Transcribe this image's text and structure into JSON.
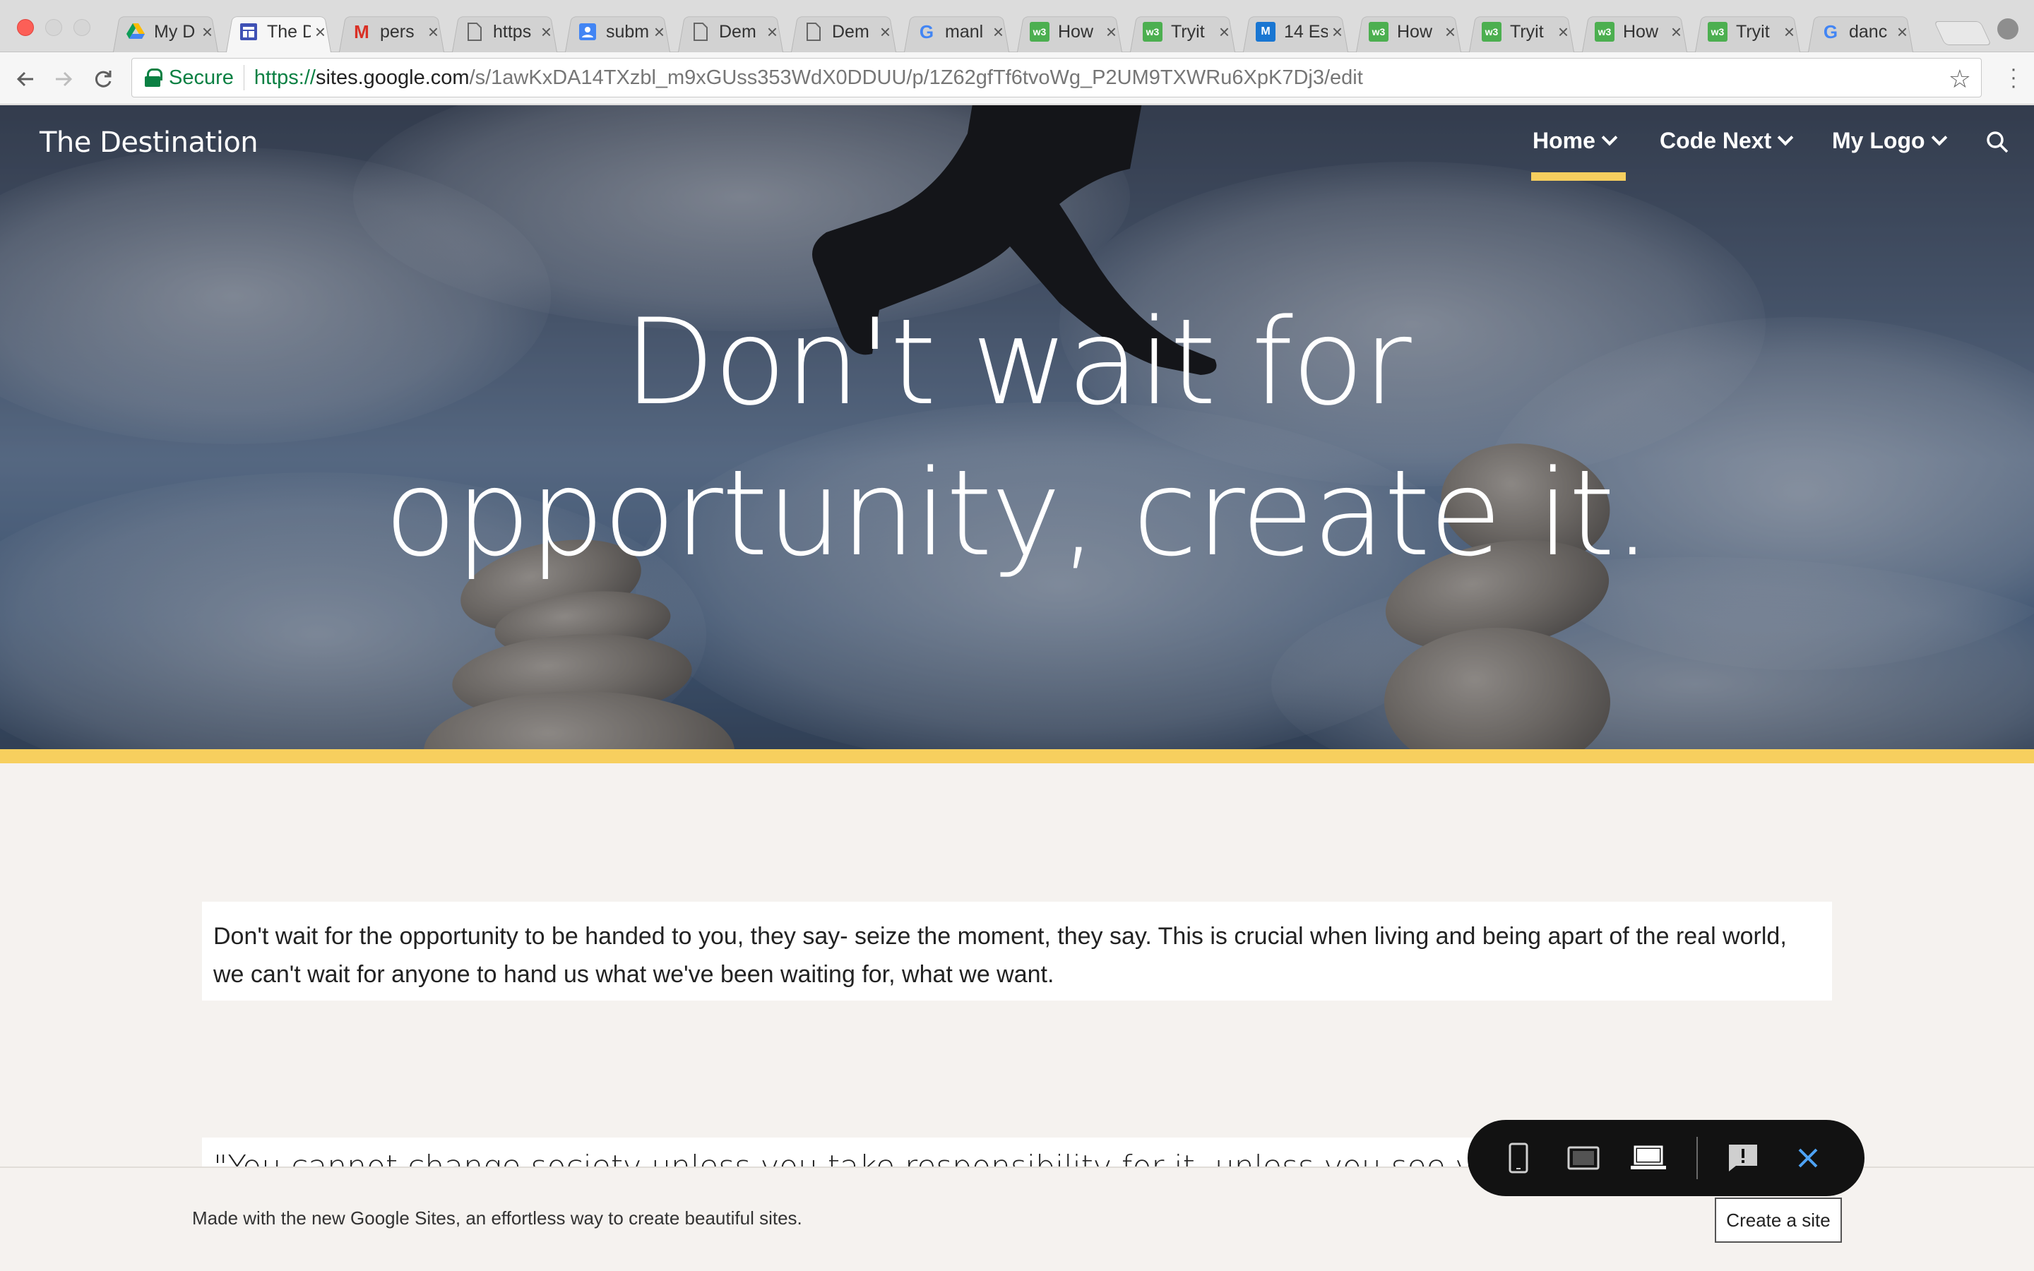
{
  "browser": {
    "tabs": [
      {
        "title": "My D",
        "icon": "drive-icon",
        "active": false
      },
      {
        "title": "The D",
        "icon": "sites-icon",
        "active": true
      },
      {
        "title": "pers",
        "icon": "gmail-icon",
        "active": false
      },
      {
        "title": "https",
        "icon": "doc-icon",
        "active": false
      },
      {
        "title": "subm",
        "icon": "contact-icon",
        "active": false
      },
      {
        "title": "Dem",
        "icon": "doc-icon",
        "active": false
      },
      {
        "title": "Dem",
        "icon": "doc-icon",
        "active": false
      },
      {
        "title": "manl",
        "icon": "google-icon",
        "active": false
      },
      {
        "title": "How",
        "icon": "w3schools-icon",
        "active": false
      },
      {
        "title": "Tryit",
        "icon": "w3schools-icon",
        "active": false
      },
      {
        "title": "14 Es",
        "icon": "blue-m-icon",
        "active": false
      },
      {
        "title": "How",
        "icon": "w3schools-icon",
        "active": false
      },
      {
        "title": "Tryit",
        "icon": "w3schools-icon",
        "active": false
      },
      {
        "title": "How",
        "icon": "w3schools-icon",
        "active": false
      },
      {
        "title": "Tryit",
        "icon": "w3schools-icon",
        "active": false
      },
      {
        "title": "danc",
        "icon": "google-icon",
        "active": false
      }
    ],
    "secure_label": "Secure",
    "url_scheme": "https://",
    "url_host": "sites.google.com",
    "url_path": "/s/1awKxDA14TXzbl_m9xGUss353WdX0DDUU/p/1Z62gfTf6tvoWg_P2UM9TXWRu6XpK7Dj3/edit"
  },
  "site": {
    "brand": "The Destination",
    "nav": [
      {
        "label": "Home",
        "active": true
      },
      {
        "label": "Code Next",
        "active": false
      },
      {
        "label": "My Logo",
        "active": false
      }
    ],
    "headline_line1": "Don't wait for",
    "headline_line2": "opportunity, create it.",
    "paragraph": "Don't wait for the opportunity to be handed to you, they say- seize the moment, they say. This is crucial when living and being apart of the real world, we can't wait for anyone to hand us what we've been waiting for, what we want.",
    "quote": "\"You cannot change society unless you take responsibility for it, unless you see yourself as belonging to it and responsible for changing it.\" -- Grace Lee Boggs",
    "accent_color": "#f7cf5e"
  },
  "footer": {
    "text": "Made with the new Google Sites, an effortless way to create beautiful sites.",
    "create_button": "Create a site"
  },
  "preview_toolbar": {
    "buttons": [
      "phone-icon",
      "tablet-icon",
      "laptop-icon",
      "feedback-icon",
      "close-icon"
    ],
    "active_color": "#4ea3f5"
  }
}
